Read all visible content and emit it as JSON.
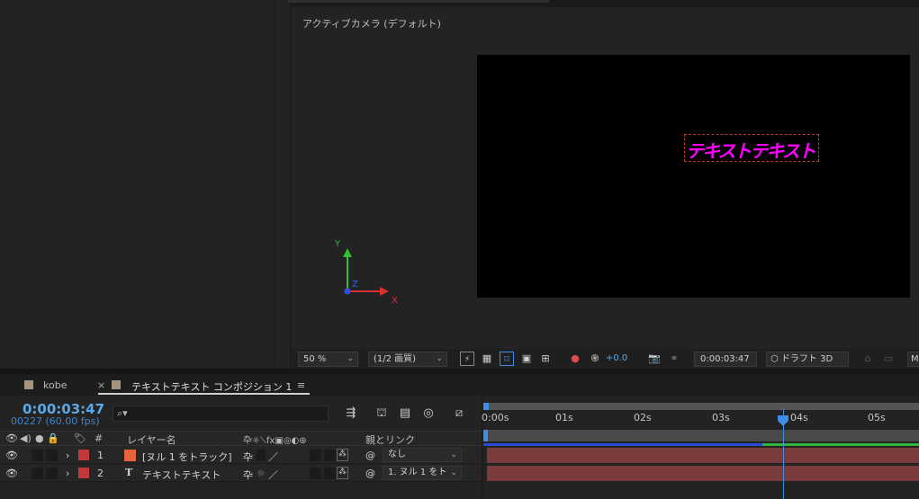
{
  "viewer": {
    "camera_label": "アクティブカメラ (デフォルト)",
    "comp_text": "テキストテキスト",
    "axis": {
      "y": "Y",
      "z": "Z",
      "x": "X"
    },
    "toolbar": {
      "zoom": "50 %",
      "resolution": "(1/2 画質)",
      "exposure": "+0.0",
      "timecode": "0:00:03:47",
      "renderer": "ドラフト 3D",
      "overflow": "M"
    }
  },
  "timeline": {
    "tabs": [
      {
        "label": "kobe",
        "color": "#a89478"
      },
      {
        "label": "テキストテキスト コンポジション 1",
        "color": "#a89478",
        "active": true
      }
    ],
    "close_glyph": "×",
    "menu_glyph": "≡",
    "timecode": "0:00:03:47",
    "frames": "00227 (60.00 fps)",
    "search": {
      "placeholder": "",
      "icon": "search-icon"
    },
    "headers": {
      "num": "#",
      "layer_name": "レイヤー名",
      "parent": "親とリンク"
    },
    "layers": [
      {
        "num": "1",
        "name": "[ヌル 1 をトラック]",
        "label_color": "#c0393b",
        "swatch_color": "#e8643c",
        "parent": "なし",
        "type": "null"
      },
      {
        "num": "2",
        "name": "テキストテキスト",
        "label_color": "#c0393b",
        "swatch_color": "",
        "parent": "1. ヌル 1 をト",
        "type": "text"
      }
    ],
    "ruler": [
      "0:00s",
      "01s",
      "02s",
      "03s",
      "04s",
      "05s"
    ],
    "colors": {
      "accent": "#3e8ee6",
      "layer_bar": "#7a3b3d",
      "progress_green": "#2fb33a",
      "progress_blue": "#2b4bd6"
    }
  }
}
